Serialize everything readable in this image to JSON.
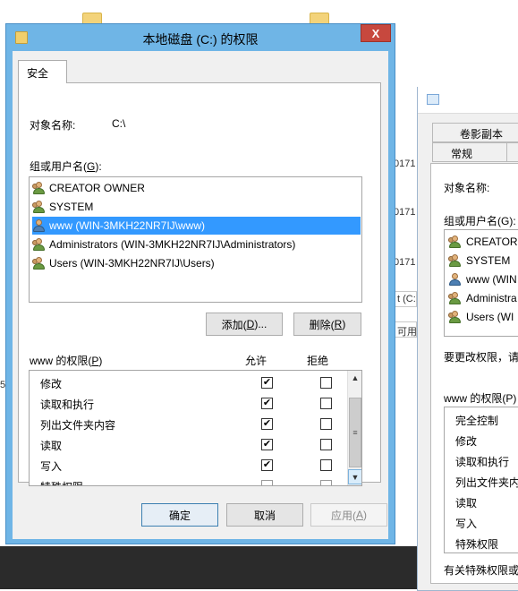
{
  "background": {
    "row_numbers": [
      "0171",
      "0171",
      "0171"
    ],
    "chip_1": "t (C:)",
    "chip_2": "可用",
    "edge_text": "5."
  },
  "dialog2": {
    "tabs": [
      "卷影副本",
      "常规"
    ],
    "object_label": "对象名称:",
    "group_label": "组或用户名(G):",
    "users": [
      "CREATOR",
      "SYSTEM",
      "www (WIN",
      "Administra",
      "Users (WI"
    ],
    "edit_hint": "要更改权限，请",
    "perm_label": "www 的权限(P)",
    "perms": [
      "完全控制",
      "修改",
      "读取和执行",
      "列出文件夹内",
      "读取",
      "写入",
      "特殊权限"
    ],
    "footer": "有关特殊权限或"
  },
  "dialog": {
    "title": "本地磁盘 (C:) 的权限",
    "close_glyph": "X",
    "tab_security": "安全",
    "object_name_label": "对象名称:",
    "object_name_value": "C:\\",
    "group_label": "组或用户名(",
    "group_label_key": "G",
    "group_label_end": "):",
    "users": [
      {
        "name": "CREATOR OWNER",
        "icon": "group-user-icon"
      },
      {
        "name": "SYSTEM",
        "icon": "group-user-icon"
      },
      {
        "name": "www (WIN-3MKH22NR7IJ\\www)",
        "icon": "user-icon"
      },
      {
        "name": "Administrators (WIN-3MKH22NR7IJ\\Administrators)",
        "icon": "group-user-icon"
      },
      {
        "name": "Users (WIN-3MKH22NR7IJ\\Users)",
        "icon": "group-user-icon"
      }
    ],
    "selected_user_index": 2,
    "add_button": {
      "pre": "添加(",
      "key": "D",
      "post": ")..."
    },
    "remove_button": {
      "pre": "删除(",
      "key": "R",
      "post": ")"
    },
    "perm_label": {
      "pre": "www 的权限(",
      "key": "P",
      "post": ")"
    },
    "col_allow": "允许",
    "col_deny": "拒绝",
    "permissions": [
      {
        "name": "修改",
        "allow": true,
        "deny": false
      },
      {
        "name": "读取和执行",
        "allow": true,
        "deny": false
      },
      {
        "name": "列出文件夹内容",
        "allow": true,
        "deny": false
      },
      {
        "name": "读取",
        "allow": true,
        "deny": false
      },
      {
        "name": "写入",
        "allow": true,
        "deny": false
      },
      {
        "name": "特殊权限",
        "allow": false,
        "deny": false
      }
    ],
    "ok_button": "确定",
    "cancel_button": "取消",
    "apply_button": {
      "pre": "应用(",
      "key": "A",
      "post": ")"
    },
    "check_glyph": "✔"
  }
}
